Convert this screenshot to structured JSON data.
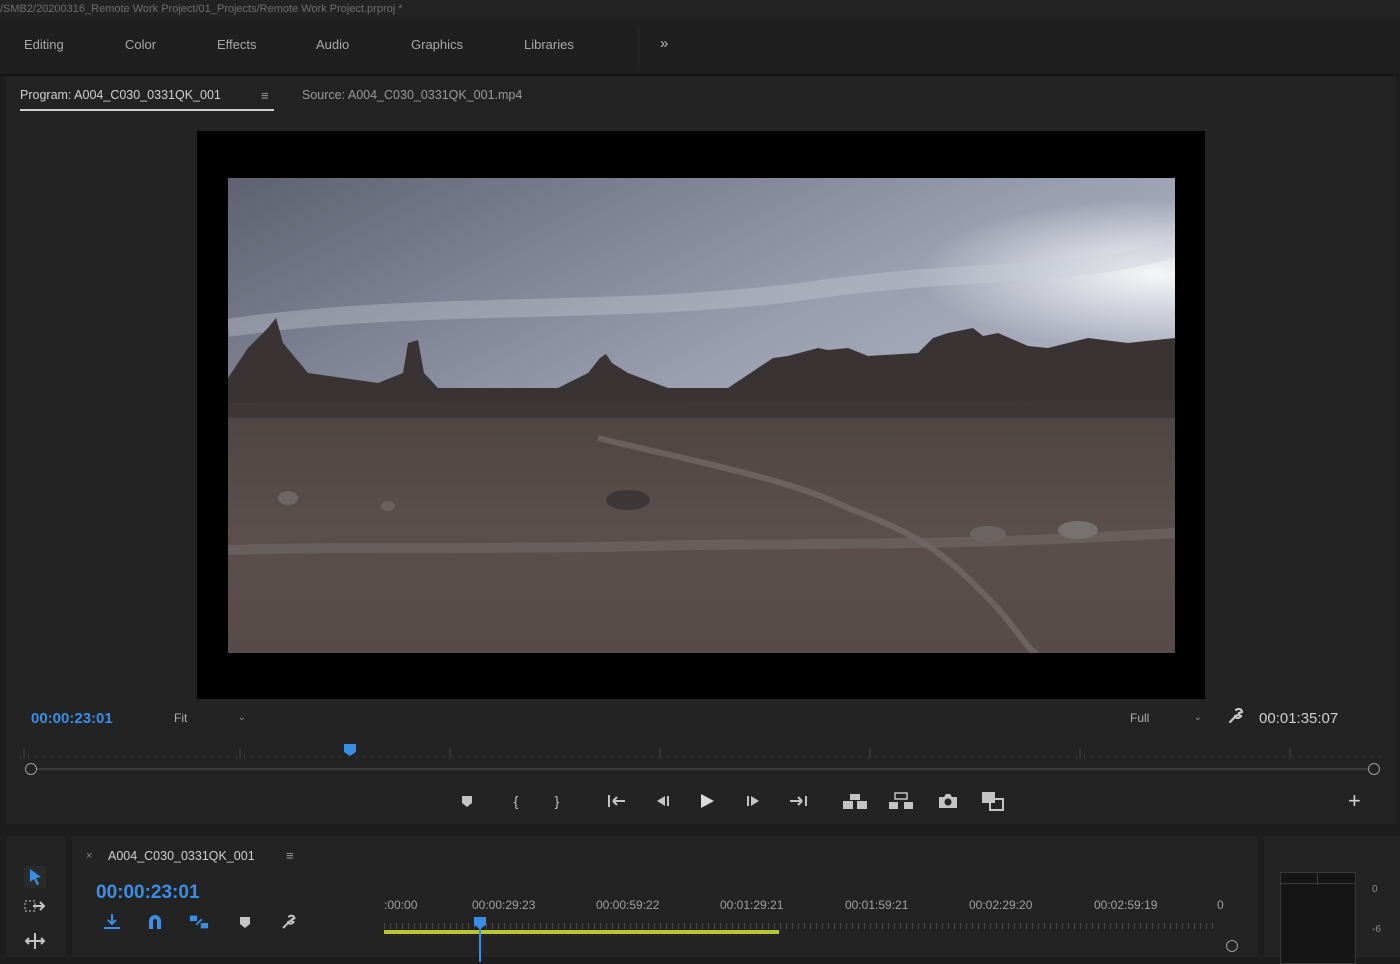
{
  "window": {
    "title": "/SMB2/20200316_Remote Work Project/01_Projects/Remote Work Project.prproj *"
  },
  "workspaces": {
    "tabs": [
      "Editing",
      "Color",
      "Effects",
      "Audio",
      "Graphics",
      "Libraries"
    ],
    "more_label": "»"
  },
  "program_monitor": {
    "tab_label": "Program: A004_C030_0331QK_001",
    "menu_icon": "hamburger-menu-icon",
    "source_tab_label": "Source: A004_C030_0331QK_001.mp4",
    "playhead_timecode": "00:00:23:01",
    "zoom_select": "Fit",
    "resolution_select": "Full",
    "duration_timecode": "00:01:35:07",
    "playhead_position_fraction": 0.24,
    "controls": {
      "marker": "marker-icon",
      "mark_in": "{",
      "mark_out": "}",
      "go_to_in": "go-to-in-icon",
      "step_back": "step-back-icon",
      "play": "play-icon",
      "step_forward": "step-forward-icon",
      "go_to_out": "go-to-out-icon",
      "lift": "lift-icon",
      "extract": "extract-icon",
      "export_frame": "camera-icon",
      "comparison_view": "comparison-view-icon",
      "add": "+"
    }
  },
  "timeline": {
    "sequence_name": "A004_C030_0331QK_001",
    "close_label": "×",
    "timecode": "00:00:23:01",
    "ruler_labels": [
      ":00:00",
      "00:00:29:23",
      "00:00:59:22",
      "00:01:29:21",
      "00:01:59:21",
      "00:02:29:20",
      "00:02:59:19"
    ],
    "ruler_trailing": "0",
    "work_area_fraction": 0.47,
    "tools": [
      "selection-tool-icon",
      "track-select-tool-icon",
      "ripple-edit-tool-icon"
    ],
    "header_icons": [
      "insert-nest-icon",
      "snap-magnet-icon",
      "linked-selection-icon",
      "add-marker-icon",
      "wrench-icon"
    ]
  },
  "audio_meter": {
    "labels": [
      "0",
      "-6"
    ]
  },
  "colors": {
    "accent_blue": "#3a8ee6",
    "work_area": "#b8c534",
    "panel_bg": "#232323"
  }
}
